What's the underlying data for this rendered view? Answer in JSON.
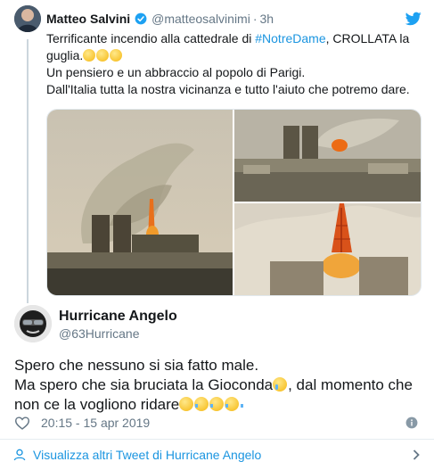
{
  "parent_tweet": {
    "author_name": "Matteo Salvini",
    "handle": "@matteosalvinimi",
    "separator": "·",
    "time": "3h",
    "text_line1_a": "Terrificante incendio alla cattedrale di ",
    "hashtag": "#NotreDame",
    "text_line1_b": ", CROLLATA la",
    "text_line2": "guglia.",
    "text_line3": "Un pensiero e un abbraccio al popolo di Parigi.",
    "text_line4": "Dall'Italia tutta la nostra vicinanza e tutto l'aiuto che potremo dare.",
    "emojis": [
      "pensive-face",
      "pensive-face",
      "pensive-face"
    ],
    "media": [
      "photo-notre-dame-smoke",
      "photo-notre-dame-roof-fire",
      "photo-notre-dame-spire-burning"
    ]
  },
  "main_tweet": {
    "author_name": "Hurricane Angelo",
    "handle": "@63Hurricane",
    "line1": "Spero che nessuno si sia fatto male.",
    "line2_a": "Ma spero che sia bruciata la Gioconda",
    "line2_b": ", dal momento che",
    "line3": "non ce la vogliono ridare",
    "emojis": [
      "crying-face",
      "relieved-face",
      "face-with-tears-of-joy",
      "face-with-tears-of-joy",
      "face-with-tears-of-joy"
    ],
    "timestamp": "20:15 - 15 apr 2019"
  },
  "footer": {
    "more_tweets_label": "Visualizza altri Tweet di Hurricane Angelo"
  },
  "colors": {
    "link": "#1b95e0",
    "secondary_text": "#657786",
    "verified": "#1da1f2",
    "twitter_bird": "#1da1f2"
  }
}
